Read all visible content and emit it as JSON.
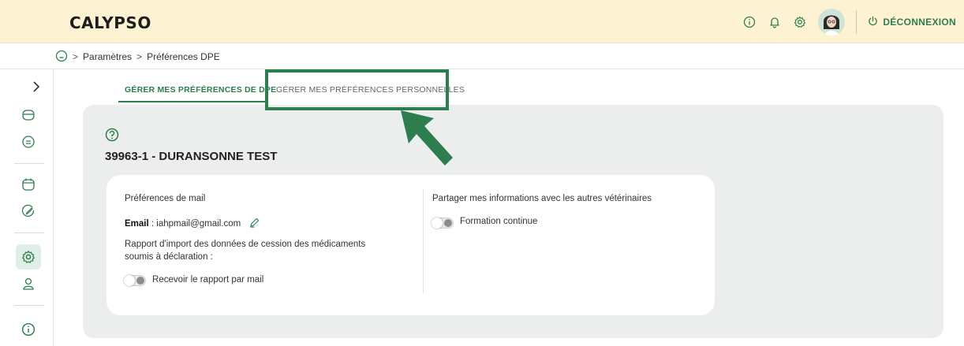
{
  "header": {
    "logo": "CALYPSO",
    "logout_label": "DÉCONNEXION",
    "icons": [
      "info-icon",
      "bell-icon",
      "gear-icon",
      "avatar",
      "power-icon"
    ]
  },
  "breadcrumb": {
    "items": [
      "Paramètres",
      "Préférences DPE"
    ]
  },
  "tabs": [
    {
      "label": "GÉRER MES PRÉFÉRENCES DE DPE",
      "active": true
    },
    {
      "label": "GÉRER MES PRÉFÉRENCES PERSONNELLES",
      "active": false
    }
  ],
  "record": {
    "title": "39963-1 - DURANSONNE TEST"
  },
  "mail_prefs": {
    "heading": "Préférences de mail",
    "email_label": "Email",
    "email_value": " : iahpmail@gmail.com",
    "report_text_line1": "Rapport d'import des données de cession des médicaments",
    "report_text_line2": "soumis à déclaration :",
    "toggle_label": "Recevoir le rapport par mail"
  },
  "share_prefs": {
    "heading": "Partager mes informations avec les autres vétérinaires",
    "toggle_label": "Formation continue"
  },
  "colors": {
    "accent": "#2e7d4f",
    "topbar": "#fdf3d3",
    "panel": "#eceeed"
  }
}
